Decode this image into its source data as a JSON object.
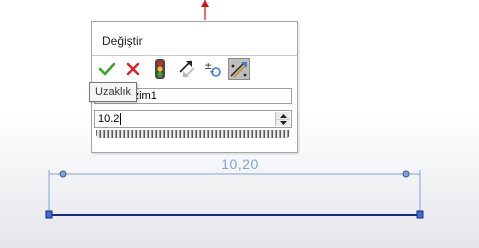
{
  "dialog": {
    "title": "Değiştir",
    "name_field_value": "D2@Çizim1",
    "value_field_value": "10.2",
    "toolbar": [
      {
        "icon": "ok-checkmark-icon",
        "label": "Tamam"
      },
      {
        "icon": "cancel-x-icon",
        "label": "İptal"
      },
      {
        "icon": "regenerate-traffic-light-icon",
        "label": "Yeniden oluştur"
      },
      {
        "icon": "reverse-dimension-arrows-icon",
        "label": "Ters çevir"
      },
      {
        "icon": "tolerance-plus-minus-icon",
        "label": "Tolerans"
      },
      {
        "icon": "mark-dimension-icon",
        "label": "Uzaklık",
        "active": true
      }
    ]
  },
  "tooltip": {
    "text": "Uzaklık"
  },
  "dimension": {
    "text": "10,20"
  },
  "colors": {
    "check_green": "#3aa52e",
    "cancel_red": "#e02020",
    "dimension_blue": "#7fa4d8",
    "sketch_line_navy": "#1a2a8c",
    "origin_arrow_red": "#d81010"
  }
}
